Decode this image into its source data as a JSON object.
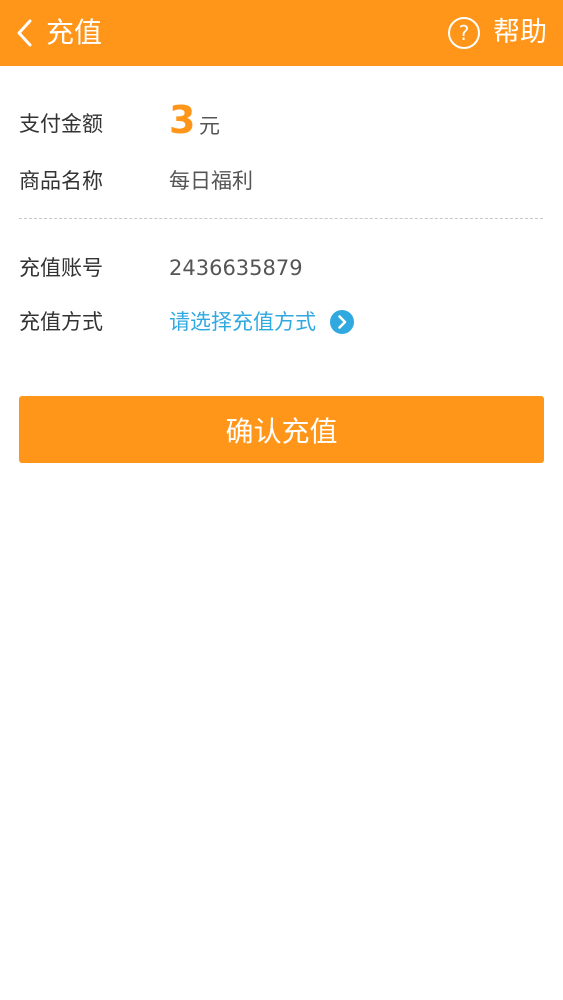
{
  "header": {
    "title": "充值",
    "help_label": "帮助",
    "back_icon": "chevron-left-icon",
    "help_icon": "question-circle-icon",
    "bg_color": "#FF9619"
  },
  "order": {
    "amount_label": "支付金额",
    "amount_value": "3",
    "amount_unit": "元",
    "product_label": "商品名称",
    "product_value": "每日福利"
  },
  "recharge": {
    "account_label": "充值账号",
    "account_value": "2436635879",
    "method_label": "充值方式",
    "method_placeholder": "请选择充值方式",
    "method_icon": "chevron-right-circle-icon",
    "link_color": "#2FA9E0"
  },
  "confirm_button": {
    "label": "确认充值"
  }
}
